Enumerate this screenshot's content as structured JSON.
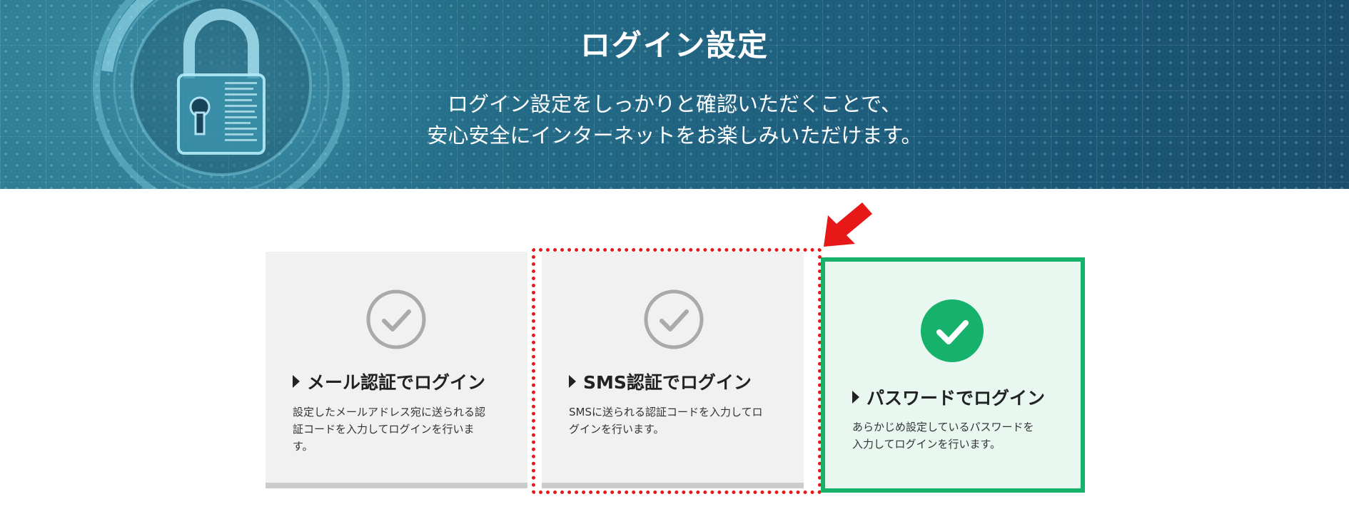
{
  "hero": {
    "title": "ログイン設定",
    "subtitle_line1": "ログイン設定をしっかりと確認いただくことで、",
    "subtitle_line2": "安心安全にインターネットをお楽しみいただけます。"
  },
  "options": [
    {
      "title": "メール認証でログイン",
      "desc_lines": [
        "設定したメールアドレス宛に送られる認",
        "証コードを入力してログインを行いま",
        "す。"
      ],
      "selected": false
    },
    {
      "title": "SMS認証でログイン",
      "desc_lines": [
        "SMSに送られる認証コードを入力してロ",
        "グインを行います。"
      ],
      "selected": false
    },
    {
      "title": "パスワードでログイン",
      "desc_lines": [
        "あらかじめ設定しているパスワードを",
        "入力してログインを行います。"
      ],
      "selected": true
    }
  ],
  "colors": {
    "selected_green": "#16b16b",
    "highlight_red": "#e81818",
    "check_gray": "#aaaaaa"
  },
  "icons": {
    "hero": "padlock-icon",
    "unselected": "check-circle-outline-icon",
    "selected": "check-circle-filled-icon",
    "annotation": "arrow-pointer-icon"
  }
}
